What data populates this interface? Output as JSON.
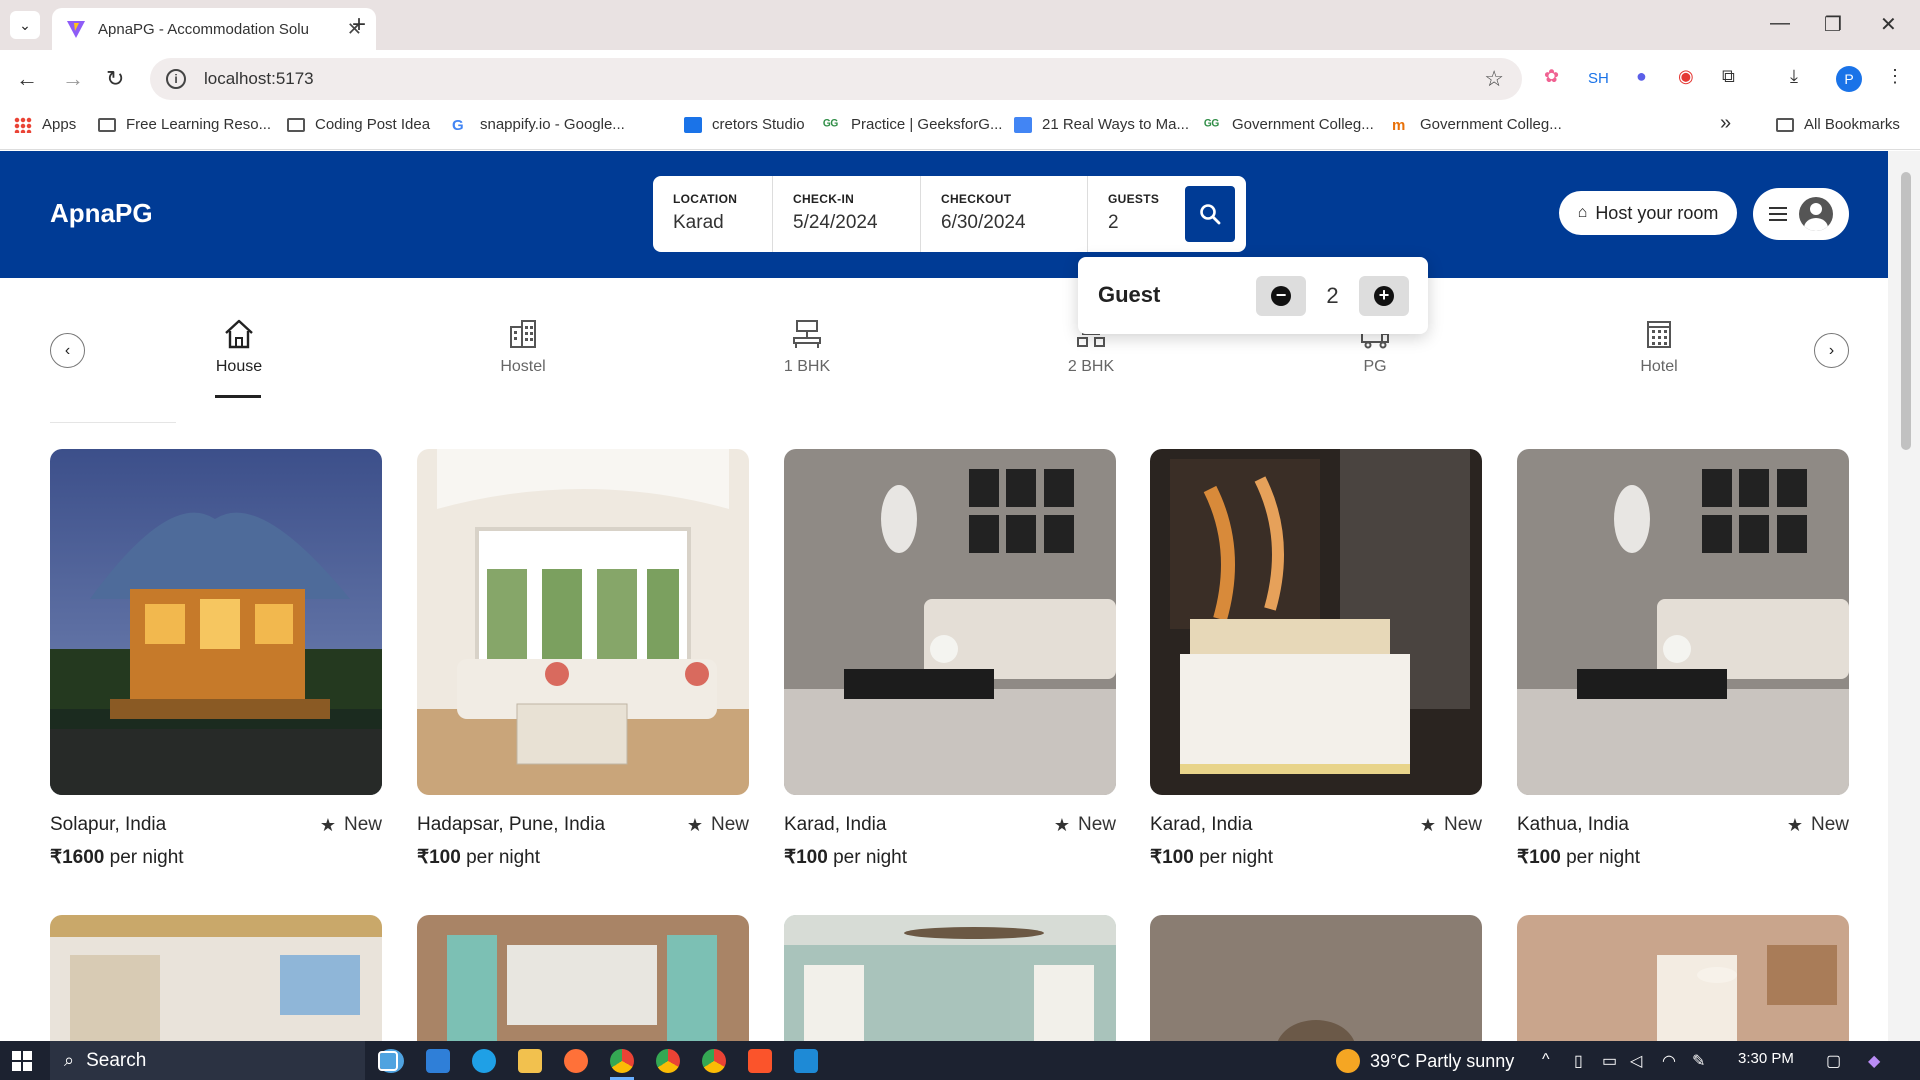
{
  "browser": {
    "tab_title": "ApnaPG - Accommodation Solu",
    "url": "localhost:5173",
    "extension_sh": "SH",
    "profile_initial": "P",
    "bookmarks": [
      {
        "label": "Apps"
      },
      {
        "label": "Free Learning Reso..."
      },
      {
        "label": "Coding Post Idea"
      },
      {
        "label": "snappify.io - Google..."
      },
      {
        "label": "cretors Studio"
      },
      {
        "label": "Practice | GeeksforG..."
      },
      {
        "label": "21 Real Ways to Ma..."
      },
      {
        "label": "Government Colleg..."
      },
      {
        "label": "Government Colleg..."
      }
    ],
    "all_bookmarks": "All Bookmarks",
    "more_bookmarks": "»"
  },
  "header": {
    "brand": "ApnaPG",
    "search": {
      "location_label": "LOCATION",
      "location_value": "Karad",
      "checkin_label": "CHECK-IN",
      "checkin_value": "5/24/2024",
      "checkout_label": "CHECKOUT",
      "checkout_value": "6/30/2024",
      "guests_label": "GUESTS",
      "guests_value": "2"
    },
    "host_button": "Host your room"
  },
  "guest_popover": {
    "label": "Guest",
    "count": "2",
    "minus": "−",
    "plus": "+"
  },
  "categories": [
    {
      "label": "House",
      "icon": "house-icon",
      "active": true
    },
    {
      "label": "Hostel",
      "icon": "building-icon"
    },
    {
      "label": "1 BHK",
      "icon": "bhk-icon"
    },
    {
      "label": "2 BHK",
      "icon": "bhk2-icon"
    },
    {
      "label": "PG",
      "icon": "pg-icon"
    },
    {
      "label": "Hotel",
      "icon": "hotel-icon"
    }
  ],
  "listings": [
    {
      "location": "Solapur, India",
      "badge": "New",
      "price": "₹1600",
      "unit": " per night"
    },
    {
      "location": "Hadapsar, Pune, India",
      "badge": "New",
      "price": "₹100",
      "unit": " per night"
    },
    {
      "location": "Karad, India",
      "badge": "New",
      "price": "₹100",
      "unit": " per night"
    },
    {
      "location": "Karad, India",
      "badge": "New",
      "price": "₹100",
      "unit": " per night"
    },
    {
      "location": "Kathua, India",
      "badge": "New",
      "price": "₹100",
      "unit": " per night"
    }
  ],
  "taskbar": {
    "search_text": "Search",
    "weather": "39°C Partly sunny",
    "time": "3:30 PM"
  },
  "colors": {
    "brand_blue": "#003b95",
    "browser_frame": "#e9e2e2"
  }
}
